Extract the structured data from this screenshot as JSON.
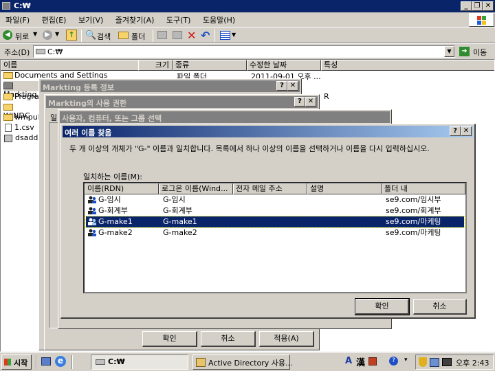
{
  "explorer": {
    "title": "C:₩",
    "menu": [
      "파일(F)",
      "편집(E)",
      "보기(V)",
      "즐겨찾기(A)",
      "도구(T)",
      "도움말(H)"
    ],
    "toolbar": {
      "back": "뒤로",
      "search": "검색",
      "folders": "폴더"
    },
    "address": {
      "label": "주소(D)",
      "value": "C:₩",
      "go": "이동"
    },
    "columns": [
      "이름",
      "크기",
      "종류",
      "수정한 날짜",
      "특성"
    ],
    "files": [
      {
        "name": "Documents and Settings",
        "type": "파일 폴더",
        "date": "2011-09-01 오후 ..."
      },
      {
        "name": "Markting",
        "type": "",
        "date": ""
      },
      {
        "name": "Progra",
        "type": "",
        "date": ""
      },
      {
        "name": "WINDC",
        "type": "",
        "date": ""
      },
      {
        "name": "wmpul",
        "type": "",
        "date": ""
      },
      {
        "name": "1.csv",
        "type": "",
        "date": ""
      },
      {
        "name": "dsadd",
        "type": "",
        "date": ""
      }
    ],
    "attr_r": "R"
  },
  "props_dialog": {
    "title": "Markting 등록 정보"
  },
  "perm_dialog": {
    "title": "Markting의 사용 권한",
    "tab_partial": "일"
  },
  "select_dialog": {
    "title": "사용자, 컴퓨터, 또는 그룹 선택"
  },
  "perm_buttons": {
    "ok": "확인",
    "cancel": "취소",
    "apply": "적용(A)"
  },
  "names_dialog": {
    "title": "여러 이름 찾음",
    "message": "두 개 이상의 개체가 \"G-\" 이름과 일치합니다. 목록에서 하나 이상의 이름을 선택하거나 이름을 다시 입력하십시오.",
    "list_label": "일치하는 이름(M):",
    "columns": [
      "이름(RDN)",
      "로그온 이름(Wind...",
      "전자 메일 주소",
      "설명",
      "폴더 내"
    ],
    "rows": [
      {
        "rdn": "G-임시",
        "logon": "G-임시",
        "email": "",
        "desc": "",
        "folder": "se9.com/임시부",
        "selected": false
      },
      {
        "rdn": "G-회계부",
        "logon": "G-회계부",
        "email": "",
        "desc": "",
        "folder": "se9.com/회계부",
        "selected": false
      },
      {
        "rdn": "G-make1",
        "logon": "G-make1",
        "email": "",
        "desc": "",
        "folder": "se9.com/마케팅",
        "selected": true
      },
      {
        "rdn": "G-make2",
        "logon": "G-make2",
        "email": "",
        "desc": "",
        "folder": "se9.com/마케팅",
        "selected": false
      }
    ],
    "ok": "확인",
    "cancel": "취소"
  },
  "taskbar": {
    "start": "시작",
    "tasks": [
      "C:₩",
      "Active Directory 사용..."
    ],
    "ime": [
      "A",
      "漢"
    ],
    "clock": "오후 2:43"
  }
}
